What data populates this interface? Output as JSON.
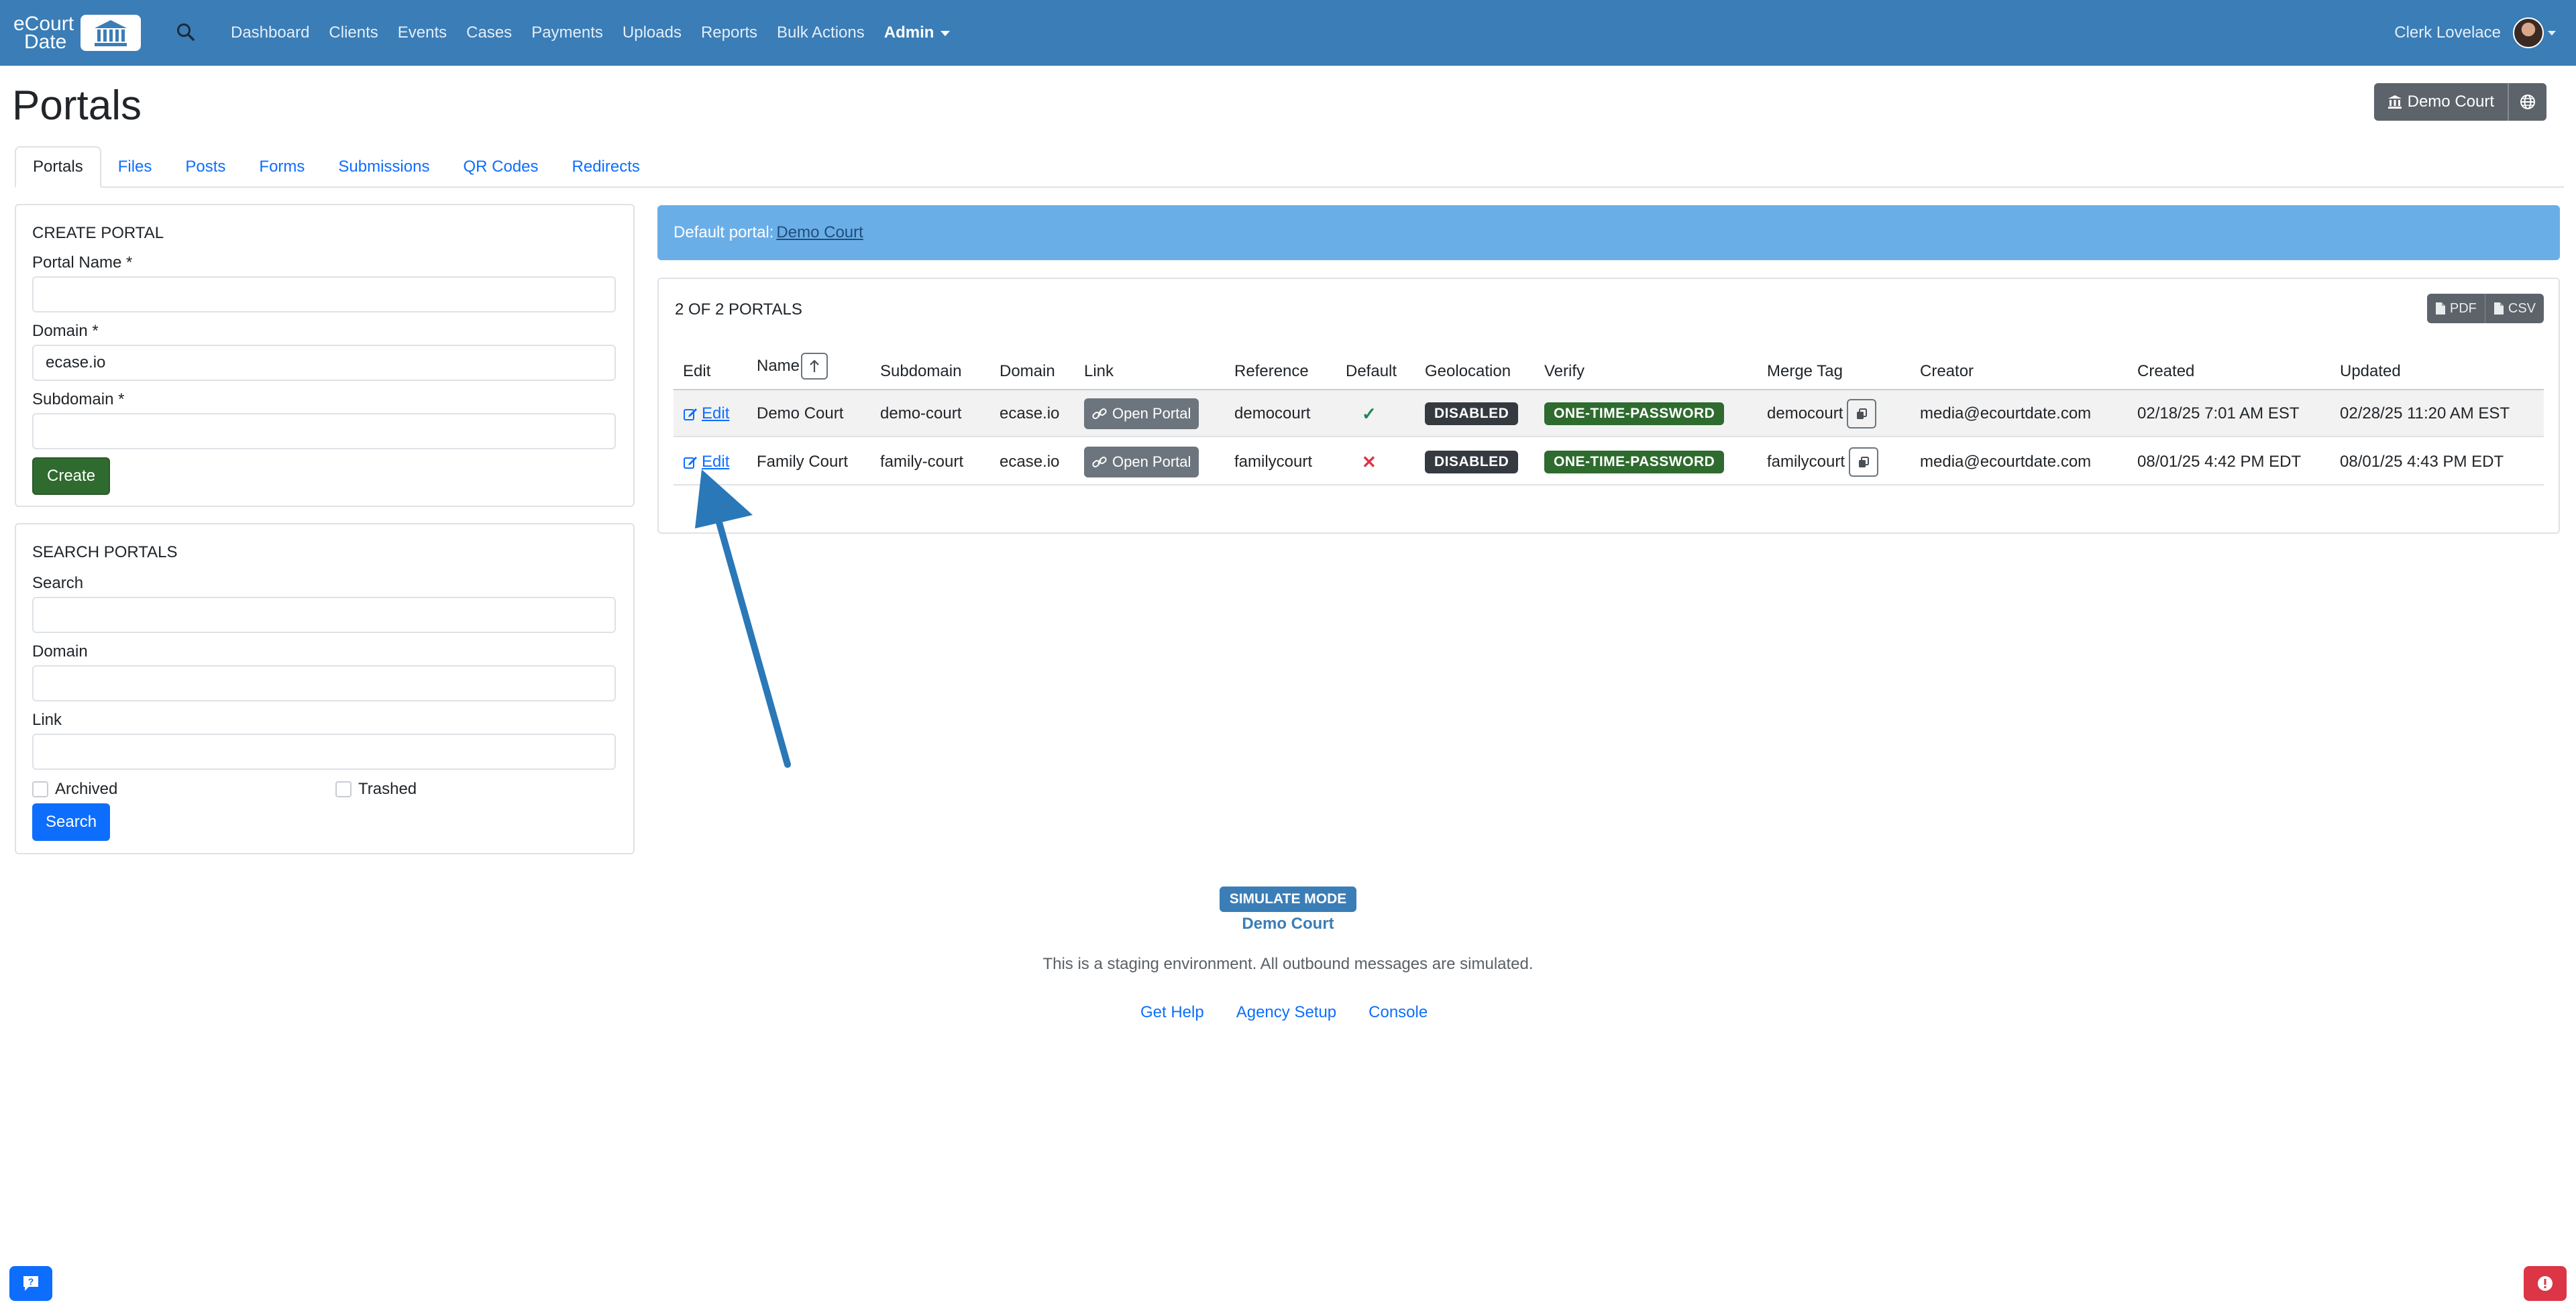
{
  "navbar": {
    "brand_line1": "eCourt",
    "brand_line2": "Date",
    "links": [
      "Dashboard",
      "Clients",
      "Events",
      "Cases",
      "Payments",
      "Uploads",
      "Reports",
      "Bulk Actions"
    ],
    "admin_label": "Admin",
    "user_name": "Clerk Lovelace"
  },
  "header": {
    "title": "Portals",
    "court_button": "Demo Court"
  },
  "tabs": [
    "Portals",
    "Files",
    "Posts",
    "Forms",
    "Submissions",
    "QR Codes",
    "Redirects"
  ],
  "create_portal": {
    "title": "CREATE PORTAL",
    "name_label": "Portal Name *",
    "name_value": "",
    "domain_label": "Domain *",
    "domain_value": "ecase.io",
    "subdomain_label": "Subdomain *",
    "subdomain_value": "",
    "create_button": "Create"
  },
  "search_portals": {
    "title": "SEARCH PORTALS",
    "search_label": "Search",
    "domain_label": "Domain",
    "link_label": "Link",
    "archived_label": "Archived",
    "trashed_label": "Trashed",
    "search_button": "Search"
  },
  "alert": {
    "prefix": "Default portal:",
    "link": "Demo Court"
  },
  "table": {
    "count": "2 OF 2 PORTALS",
    "pdf": "PDF",
    "csv": "CSV",
    "headers": {
      "edit": "Edit",
      "name": "Name",
      "subdomain": "Subdomain",
      "domain": "Domain",
      "link": "Link",
      "reference": "Reference",
      "default": "Default",
      "geolocation": "Geolocation",
      "verify": "Verify",
      "merge_tag": "Merge Tag",
      "creator": "Creator",
      "created": "Created",
      "updated": "Updated"
    },
    "rows": [
      {
        "edit": "Edit",
        "name": "Demo Court",
        "subdomain": "demo-court",
        "domain": "ecase.io",
        "link": "Open Portal",
        "reference": "democourt",
        "default": "✓",
        "geolocation": "DISABLED",
        "verify": "ONE-TIME-PASSWORD",
        "merge_tag": "democourt",
        "creator": "media@ecourtdate.com",
        "created": "02/18/25 7:01 AM EST",
        "updated": "02/28/25 11:20 AM EST"
      },
      {
        "edit": "Edit",
        "name": "Family Court",
        "subdomain": "family-court",
        "domain": "ecase.io",
        "link": "Open Portal",
        "reference": "familycourt",
        "default": "✕",
        "geolocation": "DISABLED",
        "verify": "ONE-TIME-PASSWORD",
        "merge_tag": "familycourt",
        "creator": "media@ecourtdate.com",
        "created": "08/01/25 4:42 PM EDT",
        "updated": "08/01/25 4:43 PM EDT"
      }
    ]
  },
  "footer": {
    "badge": "SIMULATE MODE",
    "court": "Demo Court",
    "note": "This is a staging environment. All outbound messages are simulated.",
    "links": [
      "Get Help",
      "Agency Setup",
      "Console"
    ]
  },
  "colors": {
    "navbar": "#3a7db7",
    "alert": "#6aaee7",
    "green": "#2f6b2f",
    "annotation_arrow": "#2a78b8"
  }
}
